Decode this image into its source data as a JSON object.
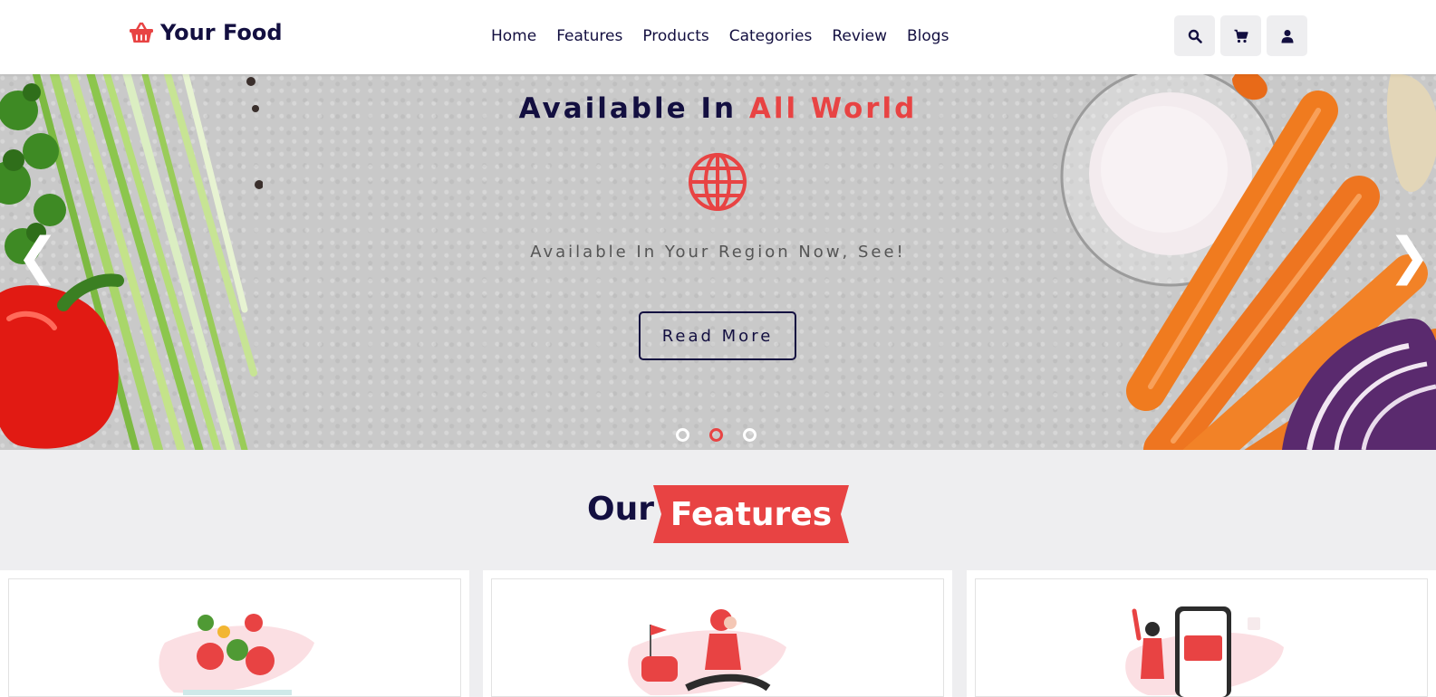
{
  "brand": {
    "name": "Your Food",
    "icon": "shopping-basket-icon",
    "accent": "#e84343",
    "primary": "#130f40"
  },
  "nav": [
    {
      "label": "Home"
    },
    {
      "label": "Features"
    },
    {
      "label": "Products"
    },
    {
      "label": "Categories"
    },
    {
      "label": "Review"
    },
    {
      "label": "Blogs"
    }
  ],
  "header_icons": [
    "search-icon",
    "cart-icon",
    "user-icon"
  ],
  "hero": {
    "title_part1": "Available In",
    "title_part2": "All World",
    "icon": "globe-icon",
    "subtitle": "Available In Your Region Now, See!",
    "button": "Read More",
    "prev_arrow": "❮",
    "next_arrow": "❯",
    "slides": 3,
    "active_slide": 2
  },
  "features": {
    "heading_part1": "Our",
    "heading_part2": "Features",
    "cards": [
      {
        "illustration": "fresh-vegetables-illustration"
      },
      {
        "illustration": "delivery-scooter-illustration"
      },
      {
        "illustration": "mobile-payment-illustration"
      }
    ]
  }
}
